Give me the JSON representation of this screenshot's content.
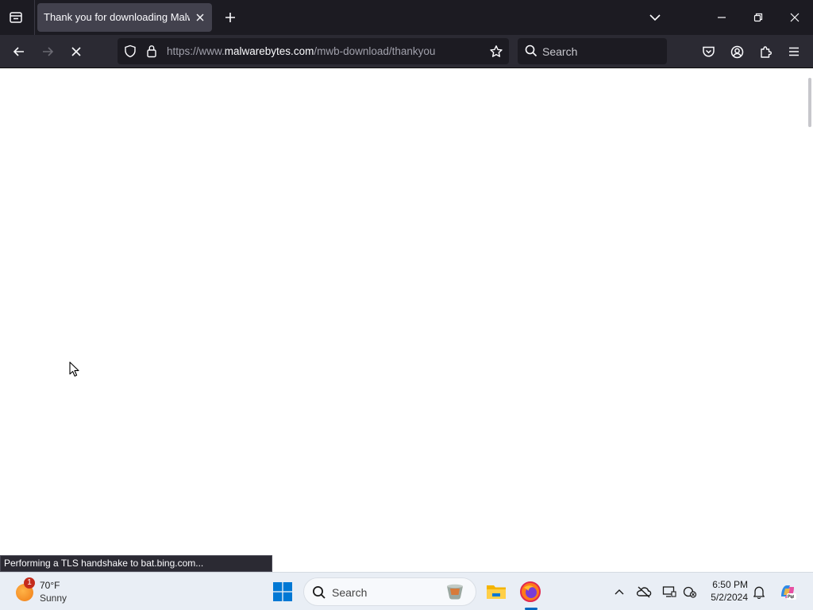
{
  "browser": {
    "tab": {
      "title": "Thank you for downloading Malwa"
    },
    "url": {
      "prefix": "https://www.",
      "domain": "malwarebytes.com",
      "path": "/mwb-download/thankyou"
    },
    "search": {
      "placeholder": "Search"
    },
    "loading": true
  },
  "content": {
    "status_text": "Performing a TLS handshake to bat.bing.com..."
  },
  "taskbar": {
    "weather": {
      "badge": "1",
      "temp": "70°F",
      "condition": "Sunny"
    },
    "search_label": "Search",
    "clock": {
      "time": "6:50 PM",
      "date": "5/2/2024"
    }
  },
  "colors": {
    "tabbar_bg": "#1c1b22",
    "toolbar_bg": "#2b2a33",
    "windows_accent": "#0078d4",
    "taskbar_bg": "#e9eef5"
  }
}
